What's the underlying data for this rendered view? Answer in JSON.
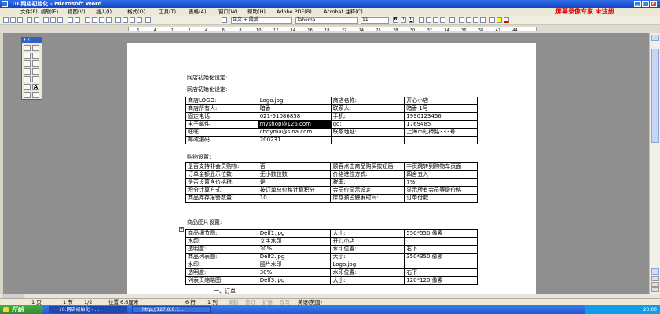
{
  "window": {
    "title": "10.网店初始化 - Microsoft Word"
  },
  "menu": {
    "items": [
      "文件(F)",
      "编辑(E)",
      "视图(V)",
      "插入(I)",
      "格式(O)",
      "工具(T)",
      "表格(A)",
      "窗口(W)",
      "帮助(H)",
      "Adobe PDF(B)",
      "Acrobat 注释(C)"
    ],
    "promo": "屏幕录像专家 未注册"
  },
  "toolbar": {
    "style": "正文 + 段后",
    "font": "Tahoma",
    "size": "11"
  },
  "ruler": {
    "labels": [
      "6",
      "4",
      "2",
      "2",
      "4",
      "6",
      "8",
      "10",
      "12",
      "14",
      "16",
      "18",
      "22",
      "24",
      "26",
      "28",
      "30",
      "32",
      "34",
      "36",
      "38",
      "42",
      "44"
    ]
  },
  "document": {
    "title1": "网店初始化设定:",
    "title2": "网店初始化设定:",
    "table1": [
      [
        "商店LOGO:",
        "Logo.jpg",
        "商店名称:",
        "开心小店"
      ],
      [
        "商店所有人:",
        "暗香",
        "联系人:",
        "暗香 1号"
      ],
      [
        "固定电话:",
        "021-51086858",
        "手机:",
        "1990123456"
      ],
      [
        "电子邮件:",
        "myshop@126.com",
        "qq:",
        "1769485"
      ],
      [
        "旺旺:",
        "cbdyma@sina.com",
        "联系地址:",
        "上海市虹桥路333号"
      ],
      [
        "邮政编码:",
        "200231",
        "",
        ""
      ]
    ],
    "section2": "购物设置:",
    "table2": [
      [
        "是否支持非会员购物:",
        "否",
        "顾客点击商品购买按钮后:",
        "丰页跳转到购物车页面"
      ],
      [
        "订单金额显示位数:",
        "无小数位数",
        "价格进位方式:",
        "四舍五入"
      ],
      [
        "是否设置含价格税:",
        "是",
        "税率:",
        "7%"
      ],
      [
        "积分计算方式:",
        "按订单总价格计算积分",
        "会员价显示设定:",
        "显示所有会员等级价格"
      ],
      [
        "商品库存报警数量:",
        "10",
        "库存预占触发时间:",
        "订单付款"
      ]
    ],
    "section3": "商品图片设置:",
    "table3": [
      [
        "商品细节图:",
        "Delf1.jpg",
        "大小:",
        "550*550 像素"
      ],
      [
        "水印:",
        "文字水印",
        "开心小店",
        ""
      ],
      [
        "透明度:",
        "30%",
        "水印位置:",
        "右下"
      ],
      [
        "商品列表图:",
        "Delf2.jpg",
        "大小:",
        "350*350 像素"
      ],
      [
        "水印:",
        "图片水印",
        "Logo.jpg",
        ""
      ],
      [
        "透明度:",
        "30%",
        "水印位置:",
        "右下"
      ],
      [
        "列表页缩略图:",
        "Delf3.jpg",
        "大小:",
        "120*120 像素"
      ]
    ],
    "truncated": "一、订单"
  },
  "status": {
    "page": "1 页",
    "section": "1 节",
    "pages": "1/2",
    "position": "位置 6.6厘米",
    "line": "6 行",
    "column": "1 列",
    "rec": "录制",
    "trk": "修订",
    "ext": "扩展",
    "ovr": "改写",
    "lang": "英语(美国)"
  },
  "taskbar": {
    "start": "开始",
    "tasks": [
      "10.网店初始化 - ...",
      "http://127.0.0.1..."
    ],
    "clock": "20:00"
  }
}
